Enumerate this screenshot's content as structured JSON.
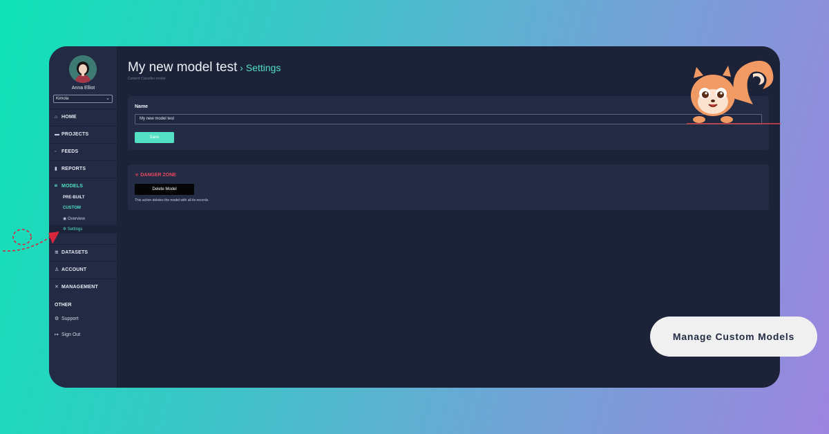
{
  "user": {
    "name": "Anna Elliot",
    "organization": "Kimola"
  },
  "sidebar": {
    "nav": [
      {
        "label": "HOME",
        "icon": "home-icon"
      },
      {
        "label": "PROJECTS",
        "icon": "folder-icon"
      },
      {
        "label": "FEEDS",
        "icon": "feed-icon"
      },
      {
        "label": "REPORTS",
        "icon": "bar-chart-icon"
      },
      {
        "label": "MODELS",
        "icon": "models-icon"
      }
    ],
    "models_sub": {
      "prebuilt": "PRE-BUILT",
      "custom": "CUSTOM"
    },
    "custom_sub": {
      "overview": "Overview",
      "settings": "Settings"
    },
    "nav2": [
      {
        "label": "DATASETS",
        "icon": "layers-icon"
      },
      {
        "label": "ACCOUNT",
        "icon": "account-icon"
      },
      {
        "label": "MANAGEMENT",
        "icon": "tools-icon"
      }
    ],
    "other_heading": "OTHER",
    "support": "Support",
    "signout": "Sign Out"
  },
  "page": {
    "title": "My new model test",
    "breadcrumb": "Settings",
    "subtitle": "Content Classifier model"
  },
  "name_card": {
    "label": "Name",
    "value": "My new model test",
    "save_label": "Save"
  },
  "danger": {
    "title": "DANGER ZONE",
    "delete_label": "Delete Model",
    "note": "This action deletes the model with all its records."
  },
  "caption": "Manage Custom Models",
  "colors": {
    "accent": "#4fe0c3",
    "danger": "#e8485e",
    "window": "#1c2238",
    "sidebar": "#232b44"
  }
}
